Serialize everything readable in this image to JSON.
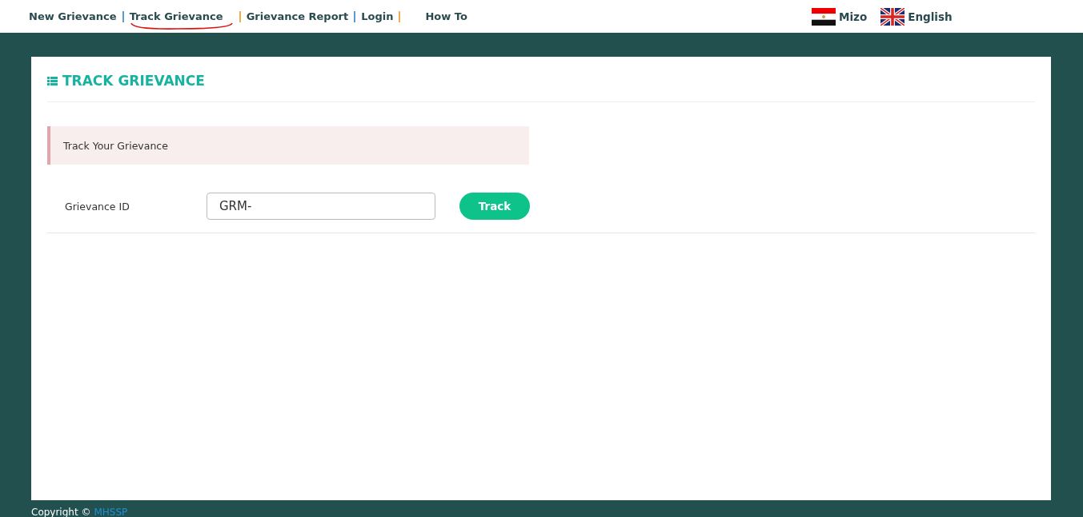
{
  "nav": [
    {
      "kind": "link",
      "label": "New Grievance",
      "underlined": false
    },
    {
      "kind": "separator",
      "color": "#5b9bd5"
    },
    {
      "kind": "link",
      "label": "Track Grievance",
      "underlined": true
    },
    {
      "kind": "separator",
      "color": "#f0ad4e"
    },
    {
      "kind": "link",
      "label": "Grievance Report",
      "underlined": false
    },
    {
      "kind": "separator",
      "color": "#5b9bd5"
    },
    {
      "kind": "link",
      "label": "Login",
      "underlined": false
    },
    {
      "kind": "separator",
      "color": "#f0ad4e"
    },
    {
      "kind": "link",
      "label": "How To",
      "underlined": false
    }
  ],
  "languages": [
    {
      "kind": "striped",
      "label": "Mizo"
    },
    {
      "kind": "union",
      "label": "English"
    }
  ],
  "panel": {
    "title": "TRACK GRIEVANCE",
    "alert": "Track Your Grievance",
    "field": {
      "label": "Grievance ID",
      "value": "GRM-"
    },
    "button": "Track"
  },
  "footer": {
    "text": "Copyright ©",
    "link": "MHSSP"
  }
}
